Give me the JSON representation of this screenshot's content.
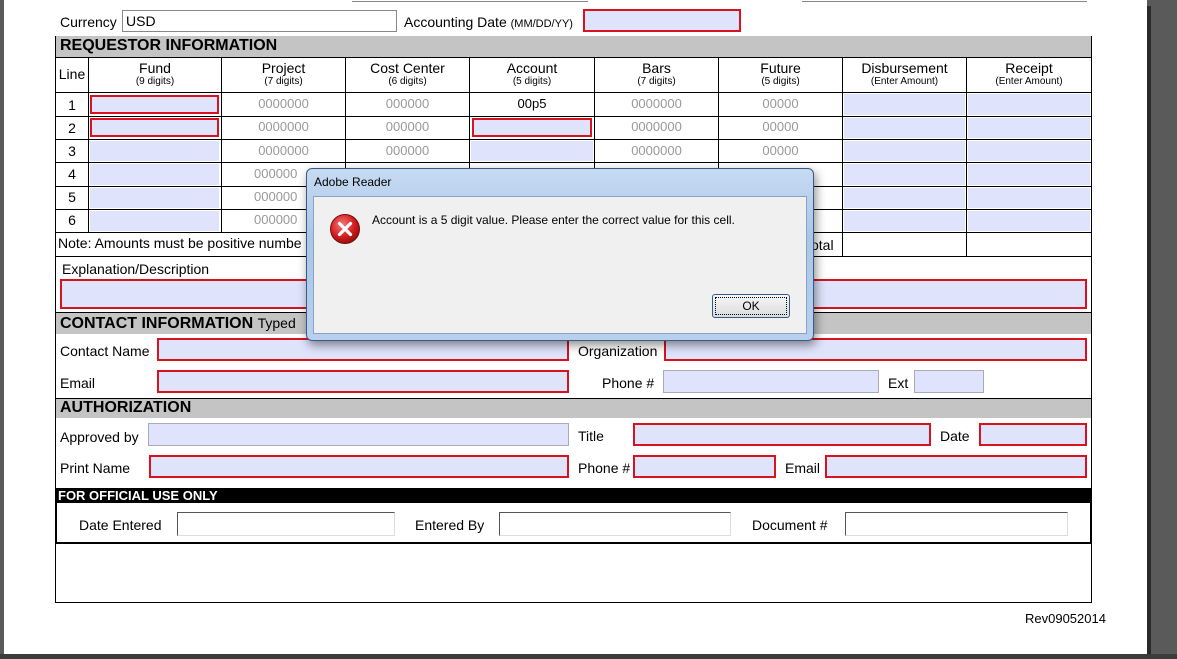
{
  "top": {
    "currency_label": "Currency",
    "currency_value": "USD",
    "accounting_date_label": "Accounting Date",
    "accounting_date_format": "(MM/DD/YY)"
  },
  "requestor": {
    "title": "REQUESTOR INFORMATION",
    "columns": [
      {
        "name": "Line",
        "hint": ""
      },
      {
        "name": "Fund",
        "hint": "(9 digits)"
      },
      {
        "name": "Project",
        "hint": "(7 digits)"
      },
      {
        "name": "Cost Center",
        "hint": "(6 digits)"
      },
      {
        "name": "Account",
        "hint": "(5 digits)"
      },
      {
        "name": "Bars",
        "hint": "(7 digits)"
      },
      {
        "name": "Future",
        "hint": "(5 digits)"
      },
      {
        "name": "Disbursement",
        "hint": "(Enter Amount)"
      },
      {
        "name": "Receipt",
        "hint": "(Enter Amount)"
      }
    ],
    "rows": [
      {
        "line": "1",
        "project": "0000000",
        "cost_center": "000000",
        "account": "00p5",
        "bars": "0000000",
        "future": "00000"
      },
      {
        "line": "2",
        "project": "0000000",
        "cost_center": "000000",
        "account": "",
        "bars": "0000000",
        "future": "00000"
      },
      {
        "line": "3",
        "project": "0000000",
        "cost_center": "000000",
        "account": "",
        "bars": "0000000",
        "future": "00000"
      },
      {
        "line": "4",
        "project": "000000",
        "cost_center": "",
        "account": "",
        "bars": "",
        "future": ""
      },
      {
        "line": "5",
        "project": "000000",
        "cost_center": "",
        "account": "",
        "bars": "",
        "future": ""
      },
      {
        "line": "6",
        "project": "000000",
        "cost_center": "",
        "account": "",
        "bars": "",
        "future": ""
      }
    ],
    "note": "Note: Amounts must be positive numbe",
    "total_label": "Total",
    "explanation_label": "Explanation/Description"
  },
  "contact": {
    "title": "CONTACT INFORMATION",
    "typed_label": "Typed",
    "contact_name_label": "Contact Name",
    "organization_label": "Organization",
    "email_label": "Email",
    "phone_label": "Phone #",
    "ext_label": "Ext"
  },
  "authorization": {
    "title": "AUTHORIZATION",
    "approved_by_label": "Approved by",
    "title_label": "Title",
    "date_label": "Date",
    "print_name_label": "Print Name",
    "phone_label": "Phone #",
    "email_label": "Email"
  },
  "official": {
    "title": "FOR OFFICIAL USE ONLY",
    "date_entered_label": "Date Entered",
    "entered_by_label": "Entered By",
    "document_label": "Document #"
  },
  "revision": "Rev09052014",
  "dialog": {
    "title": "Adobe Reader",
    "message": "Account is a 5 digit value. Please enter the correct value for this cell.",
    "ok_label": "OK",
    "icon": "error-icon"
  },
  "colors": {
    "required_border": "#d9121f",
    "field_fill": "#dfe3fb",
    "section_fill": "#c4c4c4"
  }
}
